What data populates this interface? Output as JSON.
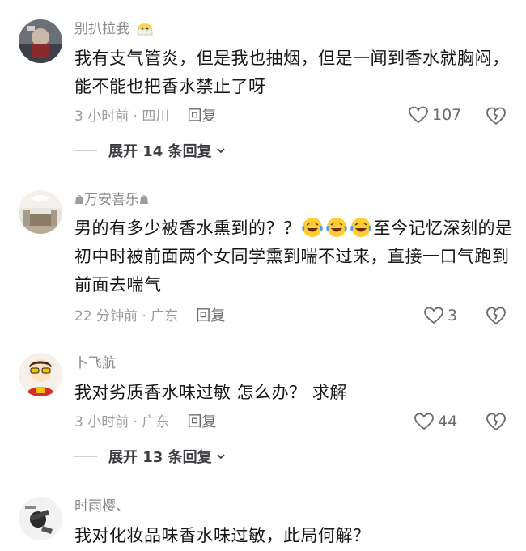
{
  "comments": [
    {
      "username": "别扒拉我",
      "username_badge": "hatching-chick-emoji",
      "text": "我有支气管炎，但是我也抽烟，但是一闻到香水就胸闷，能不能也把香水禁止了呀",
      "time_location": "3 小时前 · 四川",
      "reply_label": "回复",
      "likes": "107",
      "expand_label": "展开 14 条回复"
    },
    {
      "username": "万安喜乐",
      "username_prefix_icon": "small-bag-icon",
      "text_before_emoji": "男的有多少被香水熏到的？？",
      "emoji": [
        "laughing-crying-emoji",
        "laughing-crying-emoji",
        "laughing-crying-emoji"
      ],
      "text_after_emoji": "至今记忆深刻的是初中时被前面两个女同学熏到喘不过来，直接一口气跑到前面去喘气",
      "time_location": "22 分钟前 · 广东",
      "reply_label": "回复",
      "likes": "3"
    },
    {
      "username": "卜飞航",
      "text": "我对劣质香水味过敏  怎么办？ 求解",
      "time_location": "3 小时前 · 广东",
      "reply_label": "回复",
      "likes": "44",
      "expand_label": "展开 13 条回复"
    },
    {
      "username": "时雨樱、",
      "text": "我对化妆品味香水味过敏，此局何解？"
    }
  ],
  "colors": {
    "text": "#161616",
    "muted": "#9a9a9f",
    "username": "#8a8a8f",
    "background": "#ffffff"
  }
}
